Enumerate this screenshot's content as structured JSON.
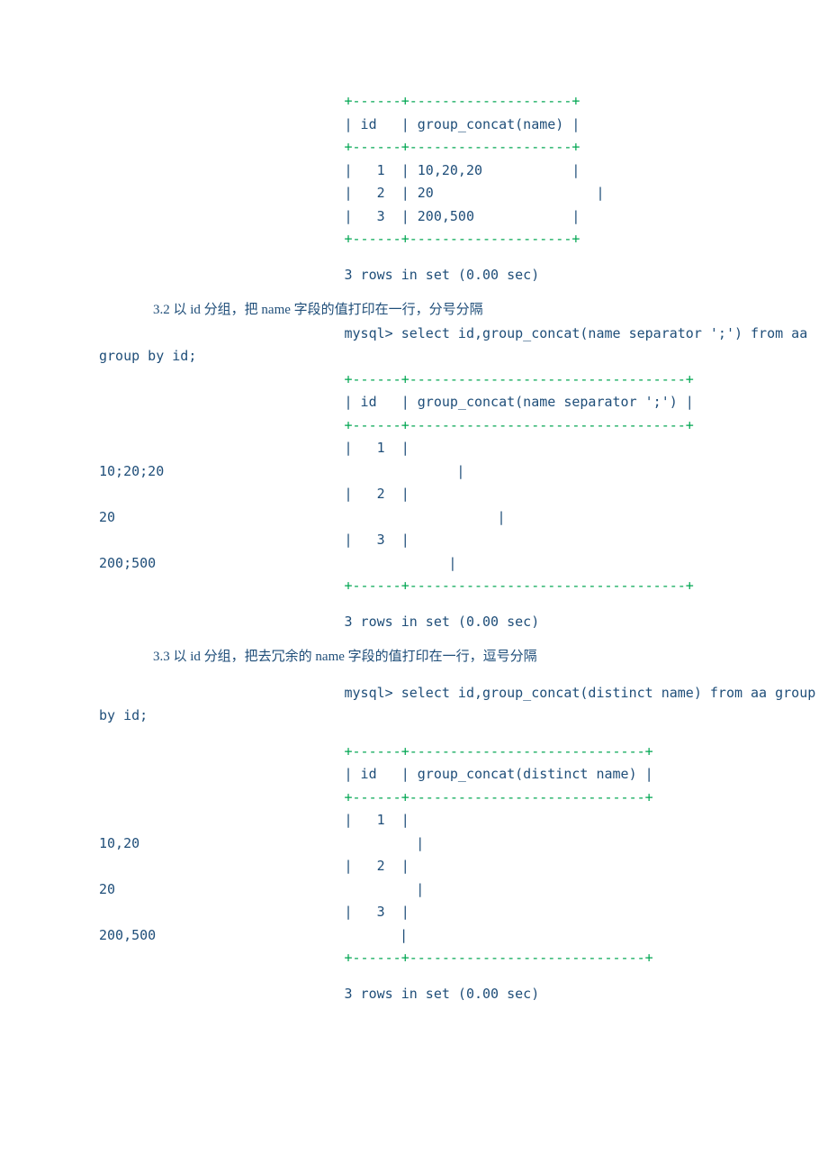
{
  "t1": {
    "border1": "                +------+--------------------+",
    "header": "                | id   | group_concat(name) |",
    "border2": "                +------+--------------------+",
    "r1": "                |   1  | 10,20,20           |",
    "r2": "                |   2  | 20                    |",
    "r3": "                |   3  | 200,500            |",
    "border3": "                +------+--------------------+",
    "summary": "                3 rows in set (0.00 sec)"
  },
  "s32": {
    "heading": "3.2 以 id 分组，把 name 字段的值打印在一行，分号分隔",
    "query1": "                mysql> select id,group_concat(name separator ';') from aa ",
    "query2": "group by id;",
    "border1": "                +------+----------------------------------+",
    "header": "                | id   | group_concat(name separator ';') |",
    "border2": "                +------+----------------------------------+",
    "r1a": "                |   1  | ",
    "r1b": "10;20;20                                    |",
    "r2a": "                |   2  | ",
    "r2b": "20                                               |",
    "r3a": "                |   3  | ",
    "r3b": "200;500                                    |",
    "border3": "                +------+----------------------------------+",
    "summary": "                3 rows in set (0.00 sec)"
  },
  "s33": {
    "heading": "3.3 以 id 分组，把去冗余的 name 字段的值打印在一行，逗号分隔",
    "query1": "                mysql> select id,group_concat(distinct name) from aa group ",
    "query2": "by id;",
    "border1": "                +------+-----------------------------+",
    "header": "                | id   | group_concat(distinct name) |",
    "border2": "                +------+-----------------------------+",
    "r1a": "                |   1  | ",
    "r1b": "10,20                                  |",
    "r2a": "                |   2  | ",
    "r2b": "20                                     |",
    "r3a": "                |   3  | ",
    "r3b": "200,500                              |",
    "border3": "                +------+-----------------------------+",
    "summary": "                3 rows in set (0.00 sec)"
  }
}
